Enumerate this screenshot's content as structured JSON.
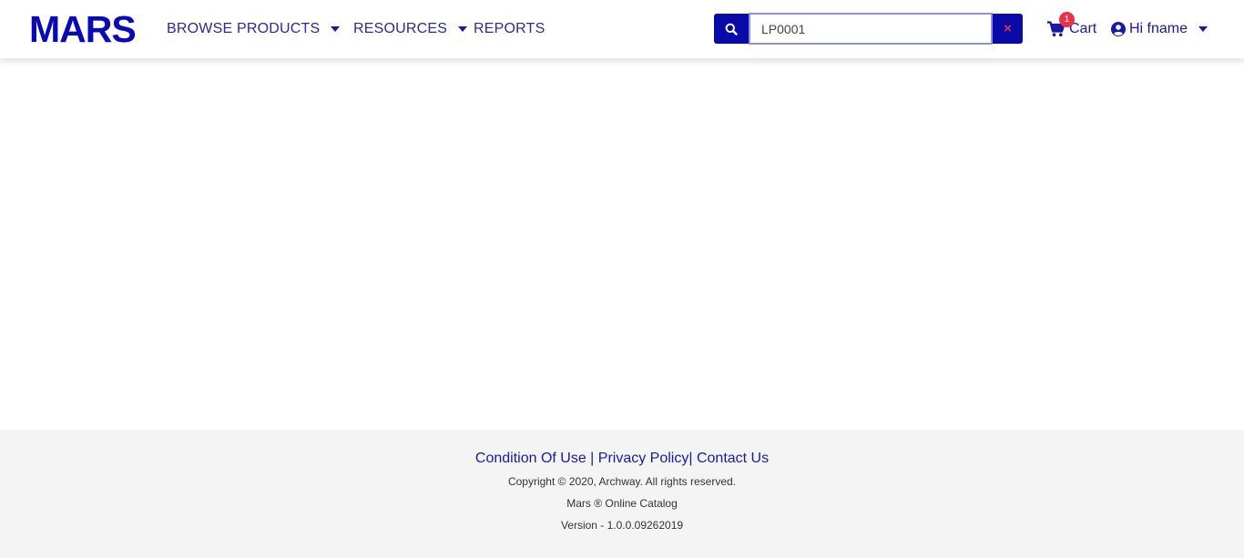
{
  "brand": {
    "logo_text": "MARS",
    "color": "#0a0ab4"
  },
  "nav": {
    "browse_products": "BROWSE PRODUCTS",
    "resources": "RESOURCES",
    "reports": "REPORTS"
  },
  "search": {
    "value": "LP0001",
    "clear_symbol": "×"
  },
  "cart": {
    "label": "Cart",
    "count": "1"
  },
  "user": {
    "greeting": "Hi fname"
  },
  "footer": {
    "links": {
      "condition_of_use": "Condition Of Use",
      "sep1": " | ",
      "privacy_policy": "Privacy Policy",
      "sep2": "| ",
      "contact_us": "Contact Us"
    },
    "copyright": "Copyright © 2020, Archway. All rights reserved.",
    "catalog": "Mars ® Online Catalog",
    "version": "Version - 1.0.0.09262019"
  },
  "colors": {
    "accent": "#0a0aa8",
    "badge": "#e8324a",
    "footer_bg": "#f4f4f4"
  },
  "icons": [
    "search-icon",
    "close-icon",
    "cart-icon",
    "user-circle-icon",
    "caret-down-icon"
  ]
}
